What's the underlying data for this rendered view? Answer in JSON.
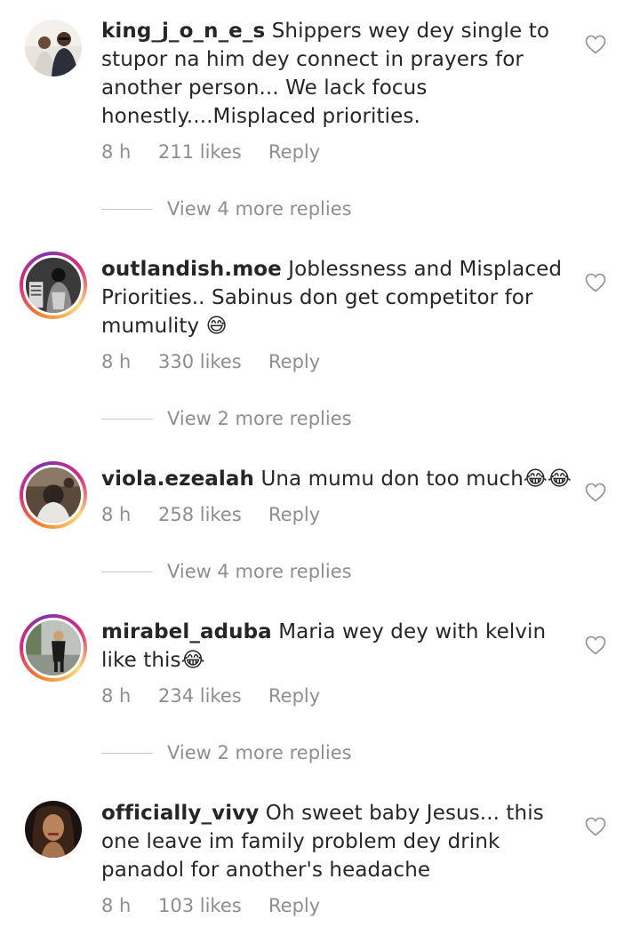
{
  "comments": [
    {
      "username": "king_j_o_n_e_s",
      "text": "Shippers wey dey single to stupor na him dey connect in prayers for another person... We lack focus honestly....Misplaced priorities.",
      "time": "8 h",
      "likes": "211 likes",
      "reply": "Reply",
      "view_replies": "View 4 more replies"
    },
    {
      "username": "outlandish.moe",
      "text": "Joblessness and Misplaced Priorities.. Sabinus don get competitor for mumulity 😅",
      "time": "8 h",
      "likes": "330 likes",
      "reply": "Reply",
      "view_replies": "View 2 more replies"
    },
    {
      "username": "viola.ezealah",
      "text": "Una mumu don too much😂😂",
      "time": "8 h",
      "likes": "258 likes",
      "reply": "Reply",
      "view_replies": "View 4 more replies"
    },
    {
      "username": "mirabel_aduba",
      "text": "Maria wey dey with kelvin like this😂",
      "time": "8 h",
      "likes": "234 likes",
      "reply": "Reply",
      "view_replies": "View 2 more replies"
    },
    {
      "username": "officially_vivy",
      "text": "Oh sweet baby Jesus... this one leave im family problem dey drink panadol for another's headache",
      "time": "8 h",
      "likes": "103 likes",
      "reply": "Reply"
    }
  ],
  "icons": {
    "like": "heart-outline-icon",
    "avatar_ring": "story-ring"
  },
  "colors": {
    "text": "#262626",
    "muted": "#8e8e8e",
    "divider": "#c7c7c7"
  }
}
